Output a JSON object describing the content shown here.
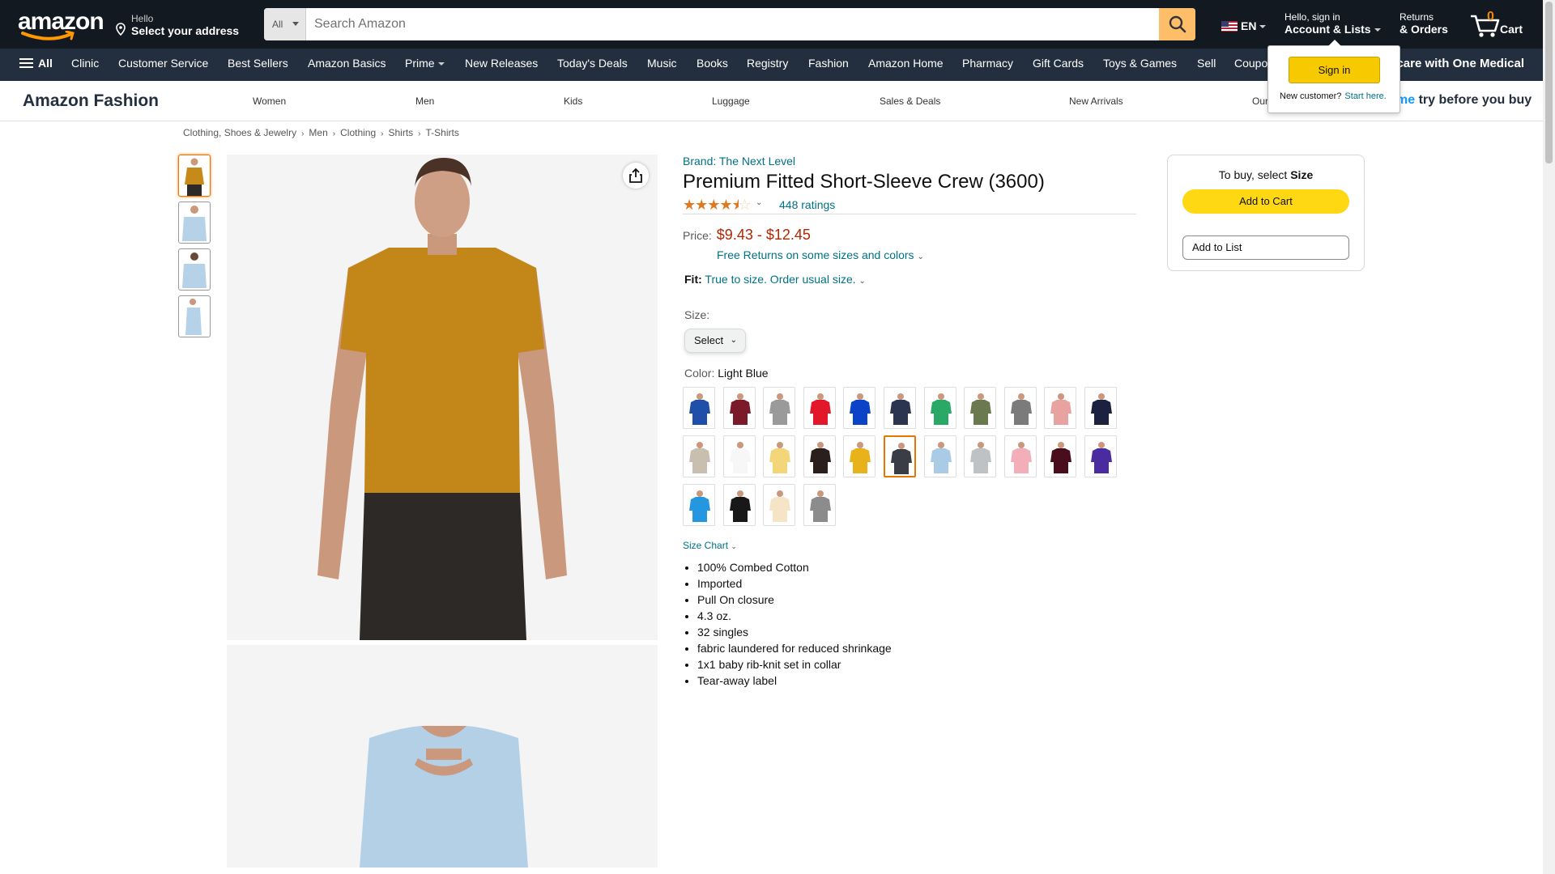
{
  "header": {
    "logo": "amazon",
    "address_line1": "Hello",
    "address_line2": "Select your address",
    "search_category": "All",
    "search_placeholder": "Search Amazon",
    "language": "EN",
    "account_line1": "Hello, sign in",
    "account_line2": "Account & Lists",
    "returns_line1": "Returns",
    "returns_line2": "& Orders",
    "cart_count": "0",
    "cart_label": "Cart"
  },
  "subnav": {
    "all": "All",
    "items": [
      "Clinic",
      "Customer Service",
      "Best Sellers",
      "Amazon Basics",
      "Prime",
      "New Releases",
      "Today's Deals",
      "Music",
      "Books",
      "Registry",
      "Fashion",
      "Amazon Home",
      "Pharmacy",
      "Gift Cards",
      "Toys & Games",
      "Sell",
      "Coupo"
    ],
    "promo": "care with One Medical"
  },
  "fashion_bar": {
    "brand": "Amazon Fashion",
    "links": [
      "Women",
      "Men",
      "Kids",
      "Luggage",
      "Sales & Deals",
      "New Arrivals",
      "Our"
    ],
    "prime_prefix": "me",
    "prime_text": " try before you buy"
  },
  "popover": {
    "signin": "Sign in",
    "new_customer": "New customer?",
    "start_here": "Start here."
  },
  "breadcrumb": [
    "Clothing, Shoes & Jewelry",
    "Men",
    "Clothing",
    "Shirts",
    "T-Shirts"
  ],
  "product": {
    "brand": "Brand: The Next Level",
    "title": "Premium Fitted Short-Sleeve Crew (3600)",
    "rating_count": "448 ratings",
    "stars": 4.5,
    "price_label": "Price:",
    "price": "$9.43 - $12.45",
    "free_returns": "Free Returns on some sizes and colors",
    "fit_label": "Fit:",
    "fit_value": "True to size. Order usual size.",
    "size_label": "Size:",
    "size_select": "Select",
    "color_label": "Color:",
    "color_value": "Light Blue",
    "size_chart": "Size Chart",
    "bullets": [
      "100% Combed Cotton",
      "Imported",
      "Pull On closure",
      "4.3 oz.",
      "32 singles",
      "fabric laundered for reduced shrinkage",
      "1x1 baby rib-knit set in collar",
      "Tear-away label"
    ],
    "swatch_colors": [
      "#1f4fa8",
      "#7a1a2a",
      "#9a9a9a",
      "#e2172a",
      "#0a43c8",
      "#2c3550",
      "#2aa866",
      "#6b7a4e",
      "#7b7b7b",
      "#e8a2a0",
      "#1c2140",
      "#c9bfb0",
      "#f7f7f7",
      "#f3d67a",
      "#2b1f1c",
      "#e8b21a",
      "#3a3d45",
      "#a9cbe6",
      "#bfc2c5",
      "#f2aeb9",
      "#4a0d1e",
      "#4a2ca0",
      "#2596e0",
      "#181818",
      "#f5e5c6",
      "#8c8c8c"
    ],
    "selected_swatch": 16
  },
  "buybox": {
    "to_buy_prefix": "To buy, select ",
    "to_buy_bold": "Size",
    "add_to_cart": "Add to Cart",
    "add_to_list": "Add to List"
  }
}
